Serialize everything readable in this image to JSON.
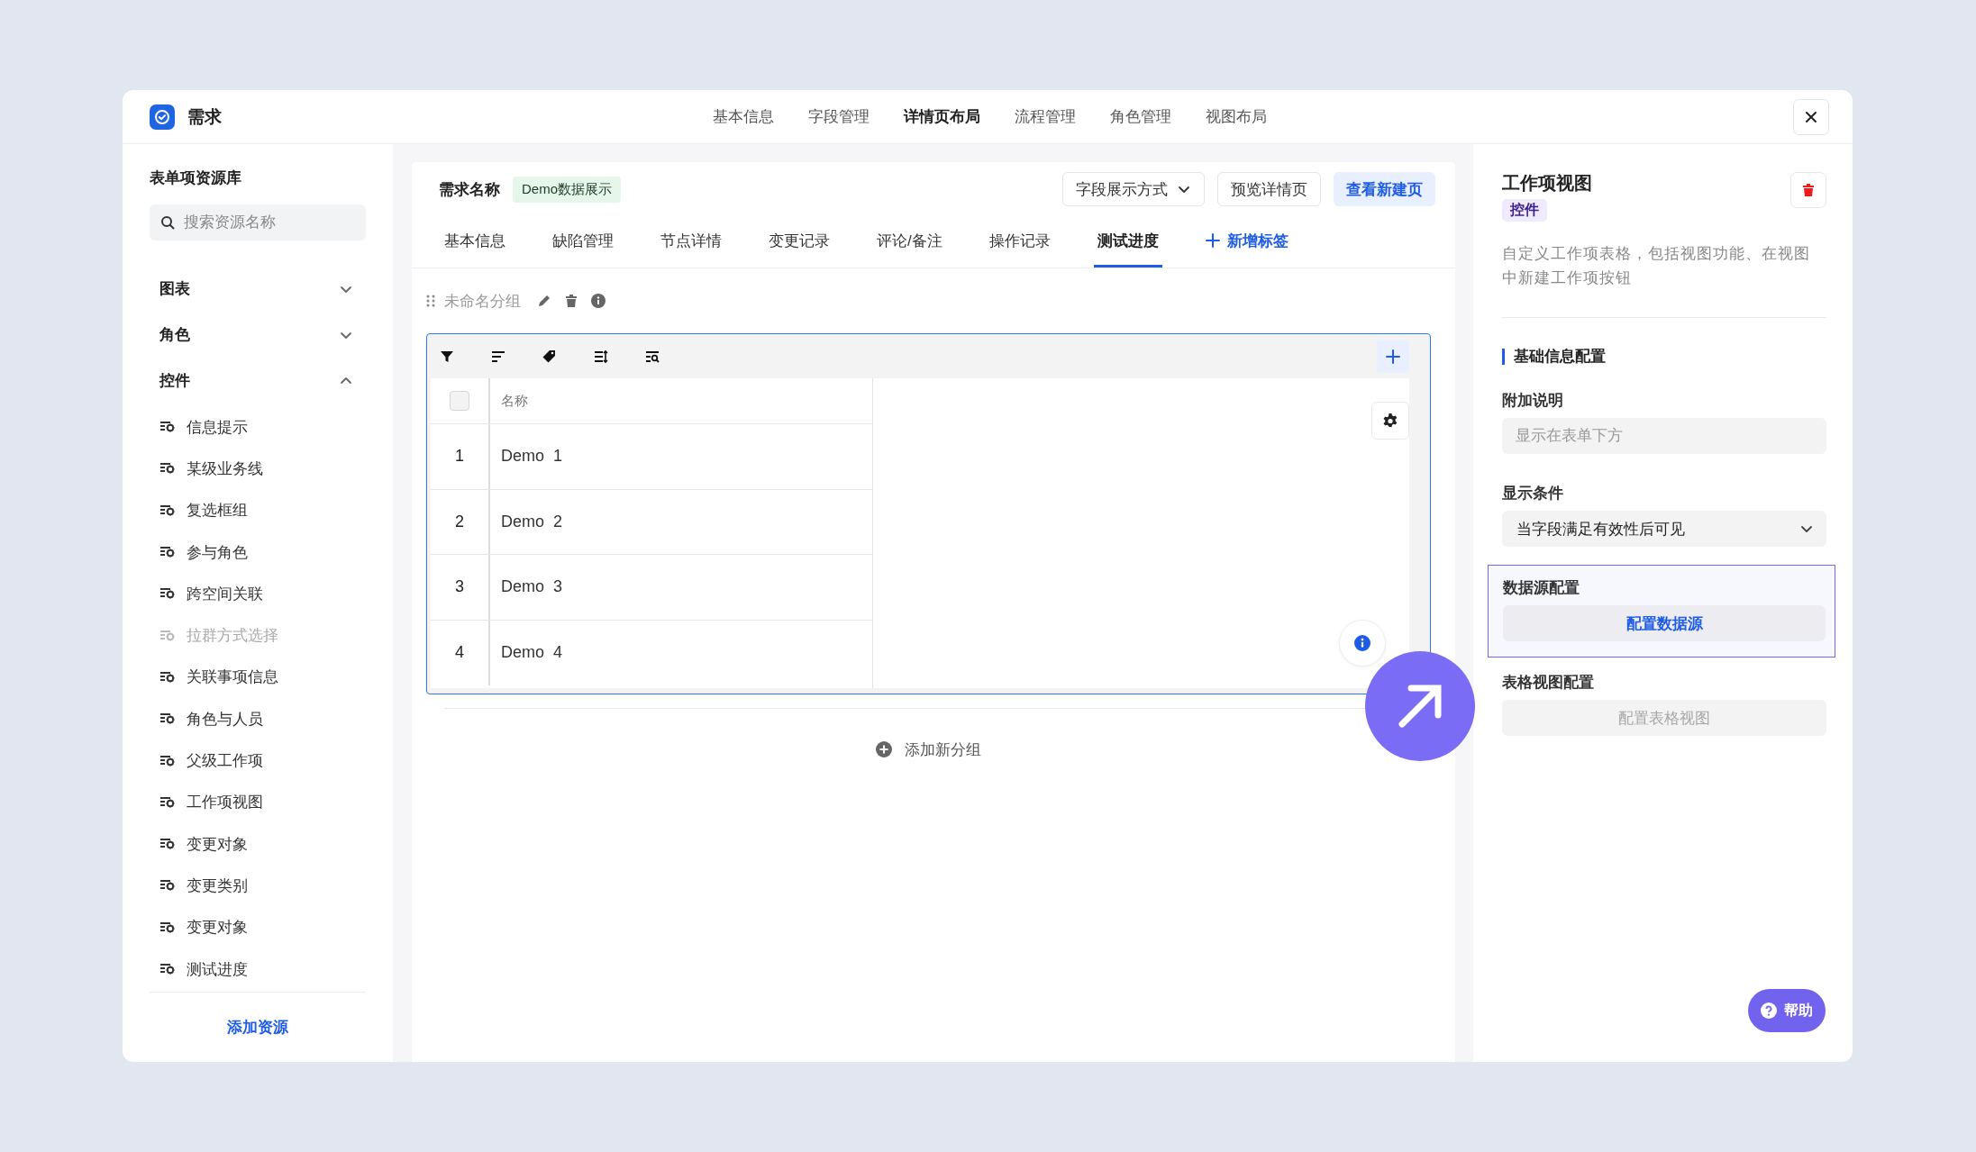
{
  "window": {
    "title": "需求"
  },
  "nav": [
    {
      "label": "基本信息",
      "selected": false
    },
    {
      "label": "字段管理",
      "selected": false
    },
    {
      "label": "详情页布局",
      "selected": true
    },
    {
      "label": "流程管理",
      "selected": false
    },
    {
      "label": "角色管理",
      "selected": false
    },
    {
      "label": "视图布局",
      "selected": false
    }
  ],
  "sidebar": {
    "title": "表单项资源库",
    "search": {
      "placeholder": "搜索资源名称"
    },
    "groups": [
      {
        "label": "图表",
        "expanded": false
      },
      {
        "label": "角色",
        "expanded": false
      },
      {
        "label": "控件",
        "expanded": true,
        "items": [
          {
            "label": "信息提示",
            "disabled": false
          },
          {
            "label": "某级业务线",
            "disabled": false
          },
          {
            "label": "复选框组",
            "disabled": false
          },
          {
            "label": "参与角色",
            "disabled": false
          },
          {
            "label": "跨空间关联",
            "disabled": false
          },
          {
            "label": "拉群方式选择",
            "disabled": true
          },
          {
            "label": "关联事项信息",
            "disabled": false
          },
          {
            "label": "角色与人员",
            "disabled": false
          },
          {
            "label": "父级工作项",
            "disabled": false
          },
          {
            "label": "工作项视图",
            "disabled": false
          },
          {
            "label": "变更对象",
            "disabled": false
          },
          {
            "label": "变更类别",
            "disabled": false
          },
          {
            "label": "变更对象",
            "disabled": false
          },
          {
            "label": "测试进度",
            "disabled": false
          }
        ]
      }
    ],
    "add_link": "添加资源"
  },
  "editor": {
    "record_label": "需求名称",
    "record_tag": "Demo数据展示",
    "buttons": [
      {
        "label": "字段展示方式",
        "kind": "dropdown"
      },
      {
        "label": "预览详情页",
        "kind": "outline"
      },
      {
        "label": "查看新建页",
        "kind": "primary"
      }
    ],
    "tabs": [
      {
        "label": "基本信息",
        "selected": false
      },
      {
        "label": "缺陷管理",
        "selected": false
      },
      {
        "label": "节点详情",
        "selected": false
      },
      {
        "label": "变更记录",
        "selected": false
      },
      {
        "label": "评论/备注",
        "selected": false
      },
      {
        "label": "操作记录",
        "selected": false
      },
      {
        "label": "测试进度",
        "selected": true
      }
    ],
    "add_tab": "新增标签",
    "group": {
      "name": "未命名分组",
      "table": {
        "select_all": {
          "checked": false
        },
        "columns": [
          "名称"
        ],
        "rows": [
          {
            "index": "1",
            "name": "Demo  1"
          },
          {
            "index": "2",
            "name": "Demo  2"
          },
          {
            "index": "3",
            "name": "Demo  3"
          },
          {
            "index": "4",
            "name": "Demo  4"
          }
        ]
      }
    },
    "add_group": "添加新分组"
  },
  "inspector": {
    "title": "工作项视图",
    "tag": "控件",
    "description": "自定义工作项表格，包括视图功能、在视图中新建工作项按钮",
    "section": "基础信息配置",
    "fields": [
      {
        "kind": "input",
        "label": "附加说明",
        "placeholder": "显示在表单下方"
      },
      {
        "kind": "select",
        "label": "显示条件",
        "value": "当字段满足有效性后可见"
      },
      {
        "kind": "button",
        "label": "数据源配置",
        "button": "配置数据源",
        "highlighted": true,
        "disabled": false
      },
      {
        "kind": "button",
        "label": "表格视图配置",
        "button": "配置表格视图",
        "highlighted": false,
        "disabled": true
      }
    ]
  },
  "help": {
    "label": "帮助"
  }
}
